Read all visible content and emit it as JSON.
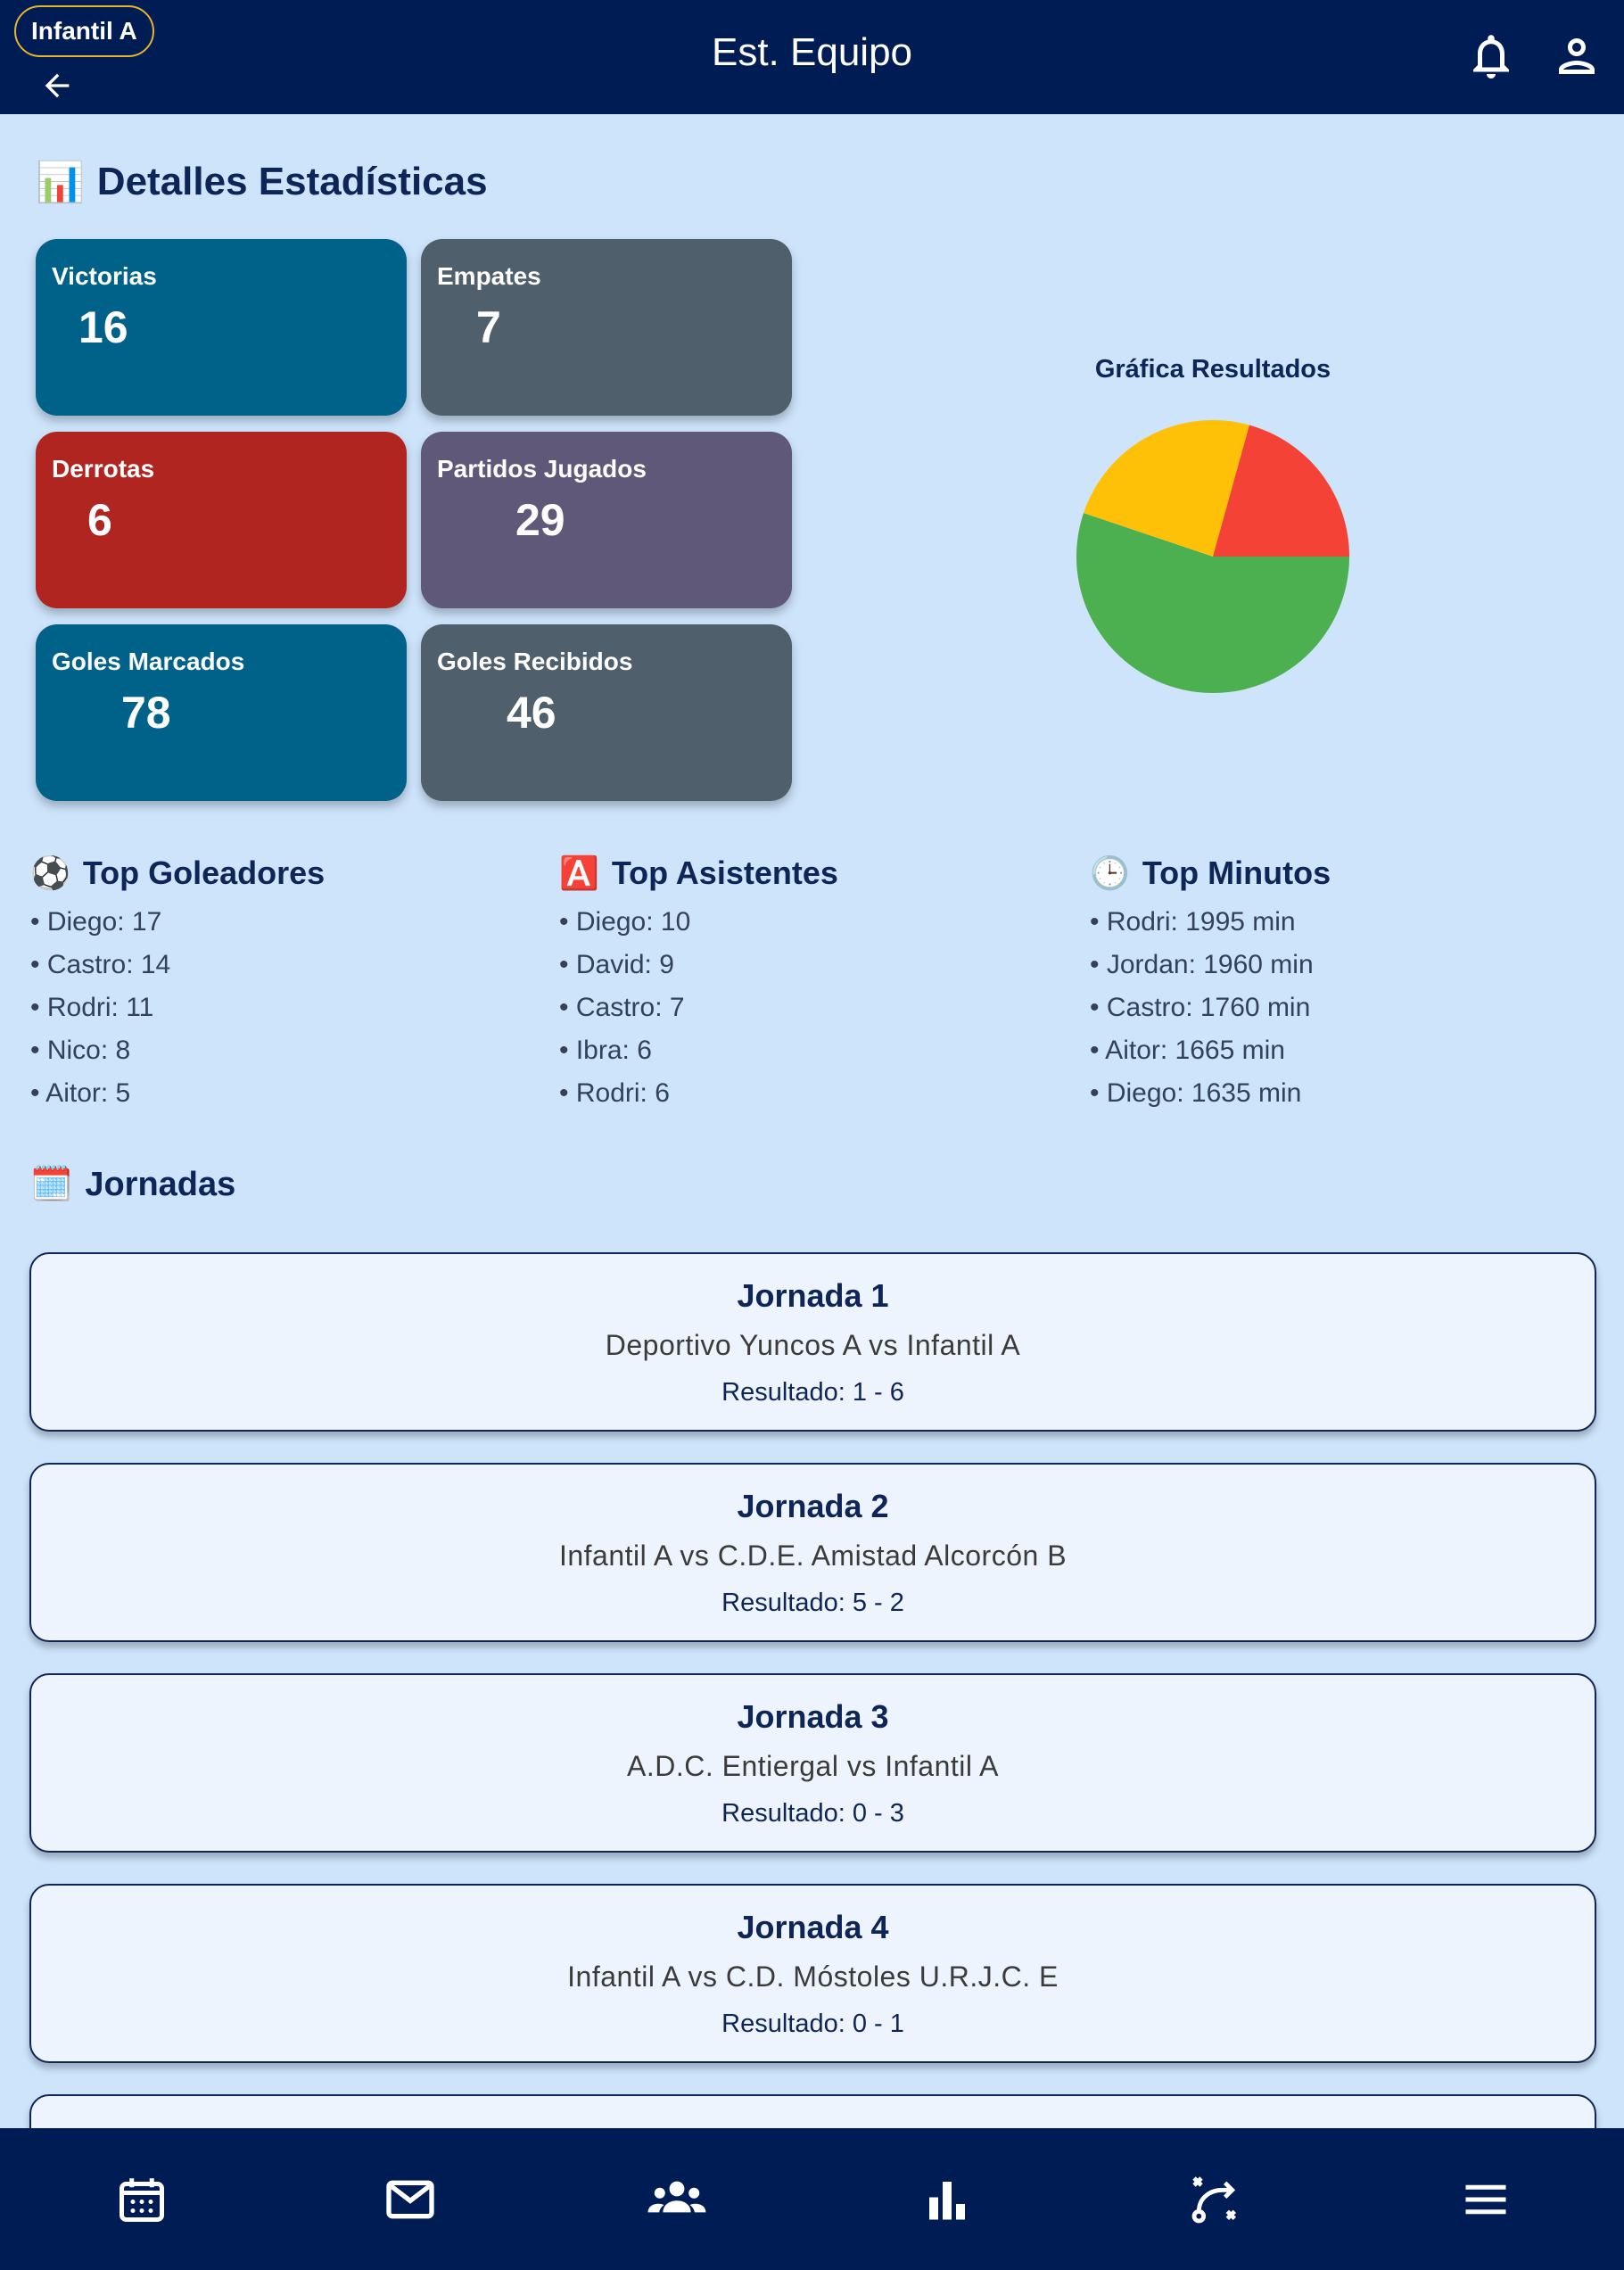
{
  "header": {
    "team": "Infantil A",
    "title": "Est. Equipo",
    "icons": [
      "arrow-left-icon",
      "bell-icon",
      "user-icon"
    ]
  },
  "stats": {
    "section_title": "Detalles Estadísticas",
    "section_emoji": "📊",
    "cards": [
      {
        "label": "Victorias",
        "value": "16",
        "color": "#006189"
      },
      {
        "label": "Empates",
        "value": "7",
        "color": "#4f5f6b"
      },
      {
        "label": "Derrotas",
        "value": "6",
        "color": "#b0251f"
      },
      {
        "label": "Partidos Jugados",
        "value": "29",
        "color": "#605878"
      },
      {
        "label": "Goles Marcados",
        "value": "78",
        "color": "#006189"
      },
      {
        "label": "Goles Recibidos",
        "value": "46",
        "color": "#4f5f6b"
      }
    ]
  },
  "chart_data": {
    "type": "pie",
    "title": "Gráfica Resultados",
    "slices": [
      {
        "value": 16,
        "color": "#4caf50"
      },
      {
        "value": 7,
        "color": "#ffc107"
      },
      {
        "value": 6,
        "color": "#f44336"
      }
    ]
  },
  "tops": [
    {
      "emoji": "⚽",
      "title": "Top Goleadores",
      "items": [
        "• Diego: 17",
        "• Castro: 14",
        "• Rodri: 11",
        "• Nico: 8",
        "• Aitor: 5"
      ]
    },
    {
      "emoji": "🅰️",
      "title": "Top Asistentes",
      "items": [
        "• Diego: 10",
        "• David: 9",
        "• Castro: 7",
        "• Ibra: 6",
        "• Rodri: 6"
      ]
    },
    {
      "emoji": "🕒",
      "title": "Top Minutos",
      "items": [
        "• Rodri: 1995 min",
        "• Jordan: 1960 min",
        "• Castro: 1760 min",
        "• Aitor: 1665 min",
        "• Diego: 1635 min"
      ]
    }
  ],
  "jornadas": {
    "emoji": "🗓️",
    "title": "Jornadas",
    "items": [
      {
        "title": "Jornada 1",
        "teams": "Deportivo Yuncos A vs Infantil A",
        "result": "Resultado: 1 - 6"
      },
      {
        "title": "Jornada 2",
        "teams": "Infantil A vs C.D.E. Amistad Alcorcón B",
        "result": "Resultado: 5 - 2"
      },
      {
        "title": "Jornada 3",
        "teams": "A.D.C. Entiergal vs Infantil A",
        "result": "Resultado: 0 - 3"
      },
      {
        "title": "Jornada 4",
        "teams": "Infantil A vs C.D. Móstoles U.R.J.C. E",
        "result": "Resultado: 0 - 1"
      }
    ]
  },
  "bottom_nav": [
    "calendar-icon",
    "mail-icon",
    "team-icon",
    "stats-icon",
    "tactics-icon",
    "menu-icon"
  ]
}
